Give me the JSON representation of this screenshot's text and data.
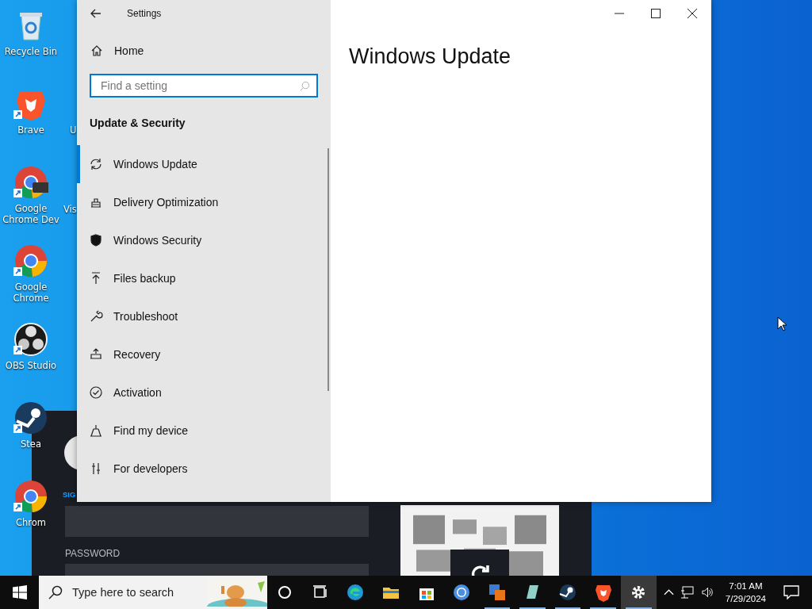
{
  "desktop_icons": [
    {
      "label": "Recycle Bin"
    },
    {
      "label": "Brave"
    },
    {
      "label": "Google Chrome Dev"
    },
    {
      "label": "Google Chrome"
    },
    {
      "label": "OBS Studio"
    },
    {
      "label": "Stea"
    },
    {
      "label": "Chrom"
    }
  ],
  "desktop_icons_hidden_labels": [
    "U",
    "Vis"
  ],
  "steam_window": {
    "account_label": "SIG",
    "password_label": "PASSWORD"
  },
  "settings": {
    "title": "Settings",
    "home": "Home",
    "search": {
      "placeholder": "Find a setting"
    },
    "section": "Update & Security",
    "page_title": "Windows Update",
    "nav_items": [
      {
        "label": "Windows Update",
        "selected": true
      },
      {
        "label": "Delivery Optimization",
        "selected": false
      },
      {
        "label": "Windows Security",
        "selected": false
      },
      {
        "label": "Files backup",
        "selected": false
      },
      {
        "label": "Troubleshoot",
        "selected": false
      },
      {
        "label": "Recovery",
        "selected": false
      },
      {
        "label": "Activation",
        "selected": false
      },
      {
        "label": "Find my device",
        "selected": false
      },
      {
        "label": "For developers",
        "selected": false
      }
    ]
  },
  "taskbar": {
    "search": {
      "placeholder": "Type here to search"
    },
    "apps": [
      {
        "running": false,
        "active": false
      },
      {
        "running": false,
        "active": false
      },
      {
        "running": false,
        "active": false
      },
      {
        "running": false,
        "active": false
      },
      {
        "running": false,
        "active": false
      },
      {
        "running": false,
        "active": false
      },
      {
        "running": true,
        "active": false
      },
      {
        "running": true,
        "active": false
      },
      {
        "running": true,
        "active": false
      },
      {
        "running": true,
        "active": false
      },
      {
        "running": true,
        "active": true
      }
    ],
    "clock": {
      "time": "7:01 AM",
      "date": "7/29/2024"
    }
  }
}
